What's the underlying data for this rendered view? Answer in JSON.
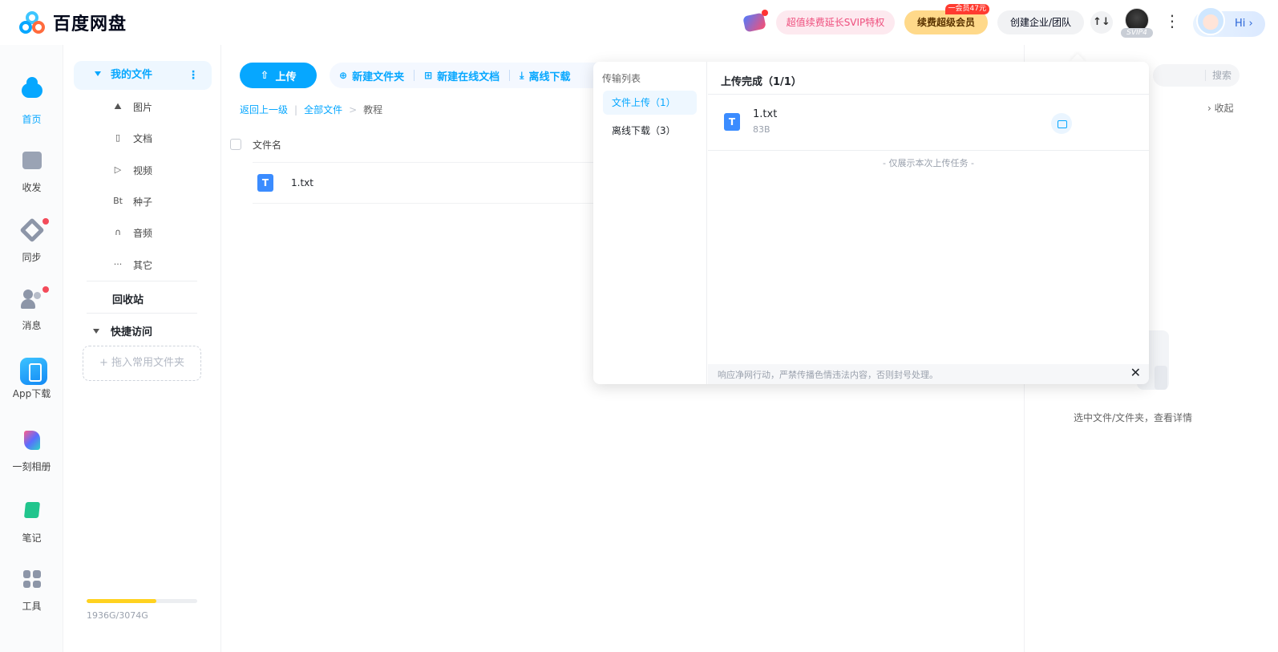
{
  "app": {
    "title": "百度网盘"
  },
  "topbar": {
    "svip_promo": "超值续费延长SVIP特权",
    "renew_label": "续费超级会员",
    "renew_tag": "一会员47元",
    "team_label": "创建企业/团队",
    "transfer_label": "↑↓",
    "member_badge": "SVIP4",
    "more_label": "⋮",
    "hi_label": "Hi ›"
  },
  "leftnav": {
    "items": [
      {
        "label": "首页"
      },
      {
        "label": "收发"
      },
      {
        "label": "同步"
      },
      {
        "label": "消息"
      },
      {
        "label": "App下载"
      },
      {
        "label": "一刻相册"
      },
      {
        "label": "笔记"
      },
      {
        "label": "工具"
      }
    ]
  },
  "sidebar": {
    "my_files": "我的文件",
    "kebab": "⋮",
    "categories": [
      {
        "icon": "图标",
        "label": "图片"
      },
      {
        "icon": "文档",
        "label": "文档"
      },
      {
        "icon": "视频",
        "label": "视频"
      },
      {
        "icon": "Bt",
        "label": "种子"
      },
      {
        "icon": "音频",
        "label": "音频"
      },
      {
        "icon": "···",
        "label": "其它"
      }
    ],
    "recycle": "回收站",
    "quick_access": "快捷访问",
    "drop_hint": "+ 拖入常用文件夹",
    "quota_text": "1936G/3074G",
    "quota_fraction": 0.63
  },
  "main": {
    "upload_label": "上传",
    "toolbar": {
      "new_folder": "新建文件夹",
      "new_doc": "新建在线文档",
      "offline": "离线下载"
    },
    "breadcrumb": {
      "back": "返回上一级",
      "sep1": "|",
      "all": "全部文件",
      "sep2": ">",
      "current": "教程"
    },
    "list_header": {
      "name": "文件名"
    },
    "files": [
      {
        "name": "1.txt",
        "icon_letter": "T"
      }
    ]
  },
  "rightpanel": {
    "search_btn": "搜索",
    "collapse_label": "› 收起",
    "hint": "选中文件/文件夹，查看详情"
  },
  "transfer_popup": {
    "title": "传输列表",
    "tabs": [
      {
        "label": "文件上传（1）"
      },
      {
        "label": "离线下载（3）"
      }
    ],
    "header": "上传完成（1/1）",
    "items": [
      {
        "name": "1.txt",
        "size": "83B",
        "icon_letter": "T"
      }
    ],
    "only_current": "- 仅展示本次上传任务 -",
    "warning": "响应净网行动，严禁传播色情违法内容，否则封号处理。",
    "close": "✕"
  },
  "colors": {
    "accent": "#06a7ff",
    "quota_fill": "#ffd21f",
    "badge_red": "#f34b5a"
  }
}
